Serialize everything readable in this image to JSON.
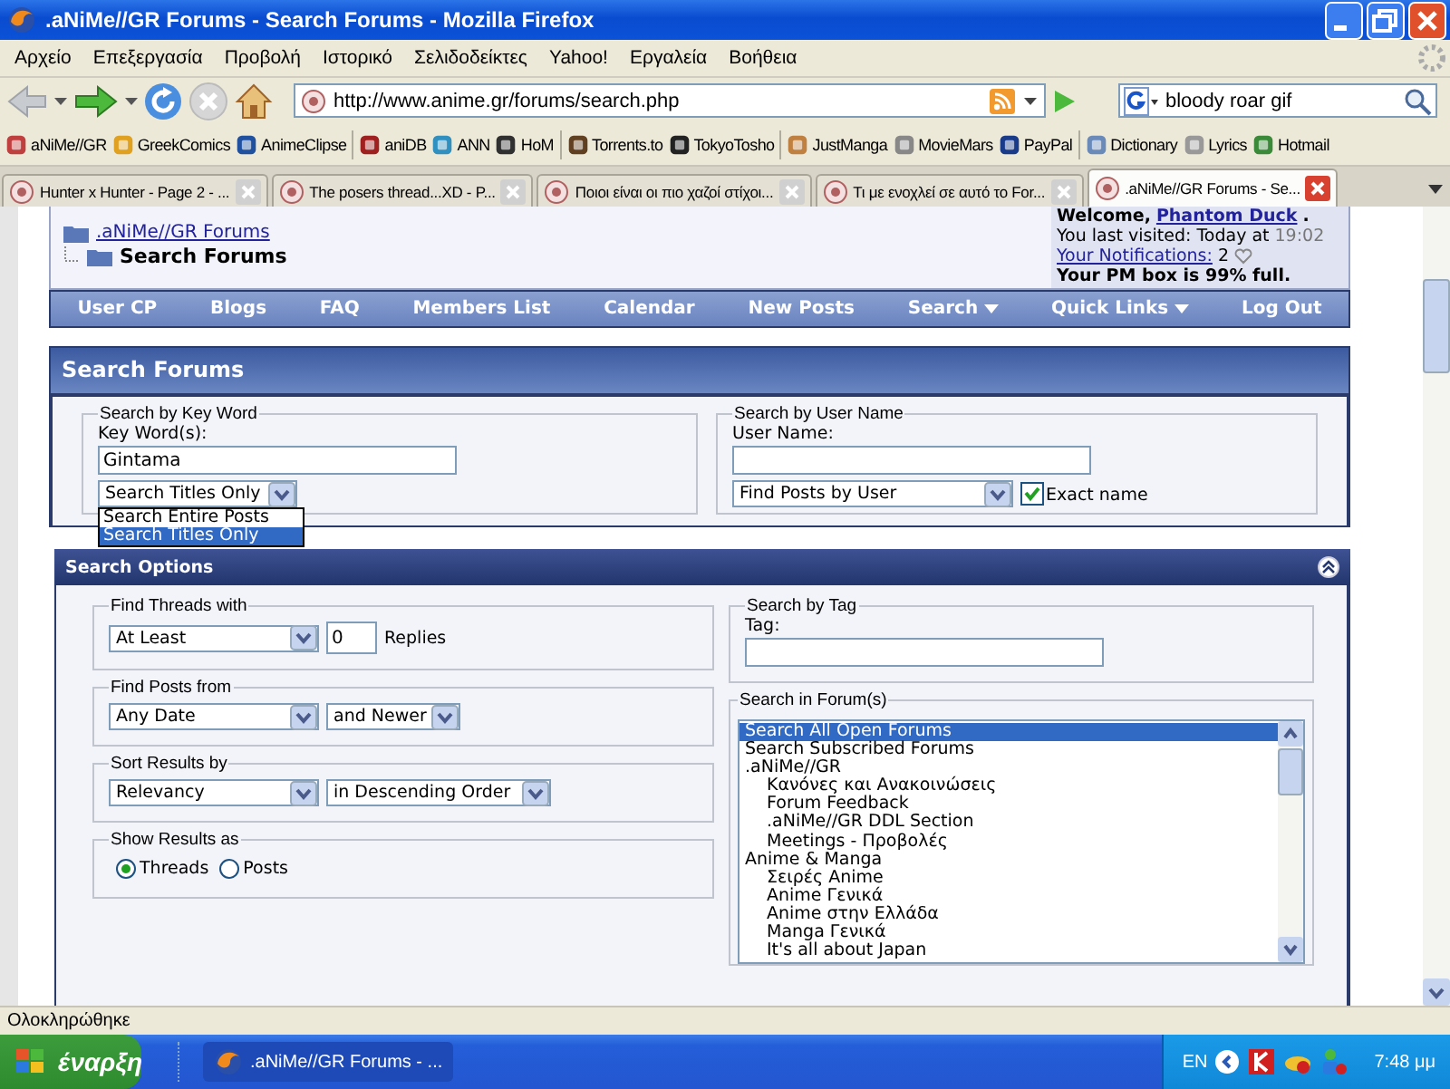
{
  "window": {
    "title": ".aNiMe//GR Forums - Search Forums - Mozilla Firefox"
  },
  "menu_bar": [
    "Αρχείο",
    "Επεξεργασία",
    "Προβολή",
    "Ιστορικό",
    "Σελιδοδείκτες",
    "Yahoo!",
    "Εργαλεία",
    "Βοήθεια"
  ],
  "address_bar": {
    "url": "http://www.anime.gr/forums/search.php"
  },
  "search_box": {
    "value": "bloody roar gif"
  },
  "bookmark_groups": [
    [
      "aNiMe//GR",
      "GreekComics",
      "AnimeClipse"
    ],
    [
      "aniDB",
      "ANN",
      "HoM"
    ],
    [
      "Torrents.to",
      "TokyoTosho"
    ],
    [
      "JustManga",
      "MovieMars",
      "PayPal"
    ],
    [
      "Dictionary",
      "Lyrics",
      "Hotmail"
    ]
  ],
  "tabs": [
    {
      "label": "Hunter x Hunter - Page 2 - ...",
      "selected": false
    },
    {
      "label": "The posers thread...XD - P...",
      "selected": false
    },
    {
      "label": "Ποιοι είναι οι πιο χαζοί στίχοι...",
      "selected": false
    },
    {
      "label": "Τι με ενοχλεί σε αυτό το For...",
      "selected": false
    },
    {
      "label": ".aNiMe//GR Forums - Se...",
      "selected": true
    }
  ],
  "breadcrumb": {
    "parent": ".aNiMe//GR Forums",
    "current": "Search Forums"
  },
  "welcome": {
    "prefix": "Welcome,",
    "user": "Phantom Duck",
    "suffix": ".",
    "last_visited": "You last visited: Today at",
    "time": "19:02",
    "notifications": "Your Notifications:",
    "notifications_count": "2",
    "pm": "Your PM box is 99% full."
  },
  "navbar": [
    {
      "label": "User CP",
      "dropdown": false
    },
    {
      "label": "Blogs",
      "dropdown": false
    },
    {
      "label": "FAQ",
      "dropdown": false
    },
    {
      "label": "Members List",
      "dropdown": false
    },
    {
      "label": "Calendar",
      "dropdown": false
    },
    {
      "label": "New Posts",
      "dropdown": false
    },
    {
      "label": "Search",
      "dropdown": true
    },
    {
      "label": "Quick Links",
      "dropdown": true
    },
    {
      "label": "Log Out",
      "dropdown": false
    }
  ],
  "search_forums": {
    "title": "Search Forums",
    "key_word": {
      "legend": "Search by Key Word",
      "label": "Key Word(s):",
      "value": "Gintama",
      "mode": "Search Titles Only",
      "options": [
        {
          "label": "Search Entire Posts",
          "selected": false
        },
        {
          "label": "Search Titles Only",
          "selected": true
        }
      ]
    },
    "user_name": {
      "legend": "Search by User Name",
      "label": "User Name:",
      "mode": "Find Posts by User",
      "exact_name": {
        "label": "Exact name",
        "checked": true
      }
    }
  },
  "search_options": {
    "title": "Search Options",
    "find_threads": {
      "legend": "Find Threads with",
      "mode": "At Least",
      "count": "0",
      "unit": "Replies"
    },
    "find_posts": {
      "legend": "Find Posts from",
      "date": "Any Date",
      "direction": "and Newer"
    },
    "sort": {
      "legend": "Sort Results by",
      "field": "Relevancy",
      "order": "in Descending Order"
    },
    "show_results": {
      "legend": "Show Results as",
      "options": [
        {
          "label": "Threads",
          "selected": true
        },
        {
          "label": "Posts",
          "selected": false
        }
      ]
    },
    "tag": {
      "legend": "Search by Tag",
      "label": "Tag:"
    },
    "forums": {
      "legend": "Search in Forum(s)",
      "items": [
        {
          "label": "Search All Open Forums",
          "selected": true
        },
        {
          "label": "Search Subscribed Forums",
          "selected": false
        },
        {
          "label": ".aNiMe//GR",
          "selected": false,
          "children": [
            {
              "label": "Κανόνες και Ανακοινώσεις",
              "selected": false
            },
            {
              "label": "Forum Feedback",
              "selected": false
            },
            {
              "label": ".aNiMe//GR DDL Section",
              "selected": false
            },
            {
              "label": "Meetings - Προβολές",
              "selected": false
            }
          ]
        },
        {
          "label": "Anime & Manga",
          "selected": false,
          "children": [
            {
              "label": "Σειρές Anime",
              "selected": false
            },
            {
              "label": "Anime Γενικά",
              "selected": false
            },
            {
              "label": "Anime στην Ελλάδα",
              "selected": false
            },
            {
              "label": "Manga Γενικά",
              "selected": false
            },
            {
              "label": "It's all about Japan",
              "selected": false
            }
          ]
        }
      ]
    }
  },
  "status_bar": {
    "text": "Ολοκληρώθηκε"
  },
  "taskbar": {
    "start": "έναρξη",
    "tasks": [
      {
        "label": ".aNiMe//GR Forums - ..."
      }
    ],
    "language": "EN",
    "clock": "7:48 μμ"
  }
}
